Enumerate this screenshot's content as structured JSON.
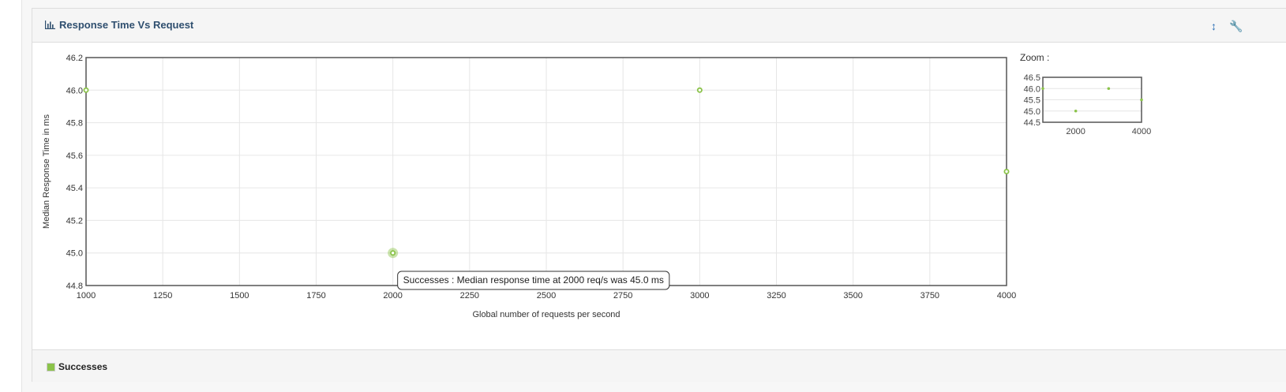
{
  "panel": {
    "title": "Response Time Vs Request",
    "icons": [
      "bar-chart-icon",
      "resize-vertical-icon",
      "wrench-icon"
    ]
  },
  "chart_data": {
    "type": "scatter",
    "title": "",
    "xlabel": "Global number of requests per second",
    "ylabel": "Median Response Time in ms",
    "xlim": [
      1000,
      4000
    ],
    "ylim": [
      44.8,
      46.2
    ],
    "x_ticks": [
      1000,
      1250,
      1500,
      1750,
      2000,
      2250,
      2500,
      2750,
      3000,
      3250,
      3500,
      3750,
      4000
    ],
    "y_ticks": [
      "44.8",
      "45.0",
      "45.2",
      "45.4",
      "45.6",
      "45.8",
      "46.0",
      "46.2"
    ],
    "grid": true,
    "legend_placement": "bottom-left",
    "series": [
      {
        "name": "Successes",
        "color": "#8bc34a",
        "points": [
          {
            "x": 1000,
            "y": 46.0
          },
          {
            "x": 2000,
            "y": 45.0
          },
          {
            "x": 3000,
            "y": 46.0
          },
          {
            "x": 4000,
            "y": 45.5
          }
        ]
      }
    ],
    "tooltip": {
      "text": "Successes : Median response time at 2000 req/s was 45.0 ms",
      "point_x": 2000,
      "point_y": 45.0
    }
  },
  "zoom": {
    "label": "Zoom :",
    "xlim": [
      1000,
      4000
    ],
    "ylim": [
      44.5,
      46.5
    ],
    "x_ticks": [
      "2000",
      "4000"
    ],
    "y_ticks": [
      "46.5",
      "46.0",
      "45.5",
      "45.0",
      "44.5"
    ]
  },
  "legend": {
    "items": [
      {
        "label": "Successes",
        "color": "#8bc34a"
      }
    ]
  }
}
